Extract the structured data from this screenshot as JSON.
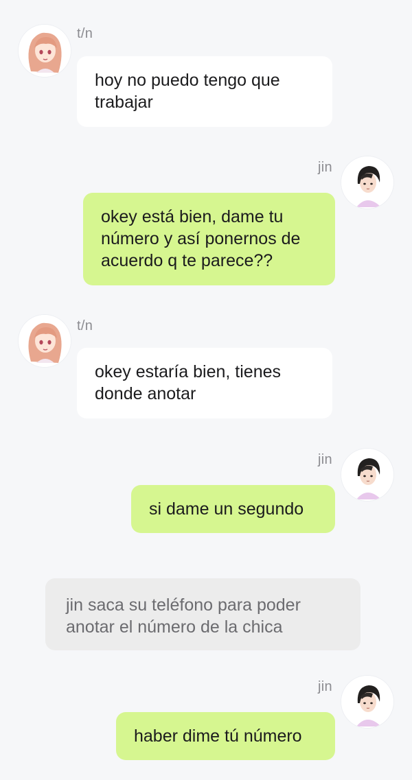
{
  "colors": {
    "background": "#f6f7f9",
    "incoming_bubble": "#ffffff",
    "outgoing_bubble": "#d6f690",
    "narration_bubble": "#ececec",
    "name_text": "#8b8b90"
  },
  "participants": {
    "her": {
      "name": "t/n",
      "avatar": "anime-girl-avatar"
    },
    "him": {
      "name": "jin",
      "avatar": "anime-boy-avatar"
    }
  },
  "messages": [
    {
      "sender": "t/n",
      "text": "hoy no puedo tengo que\ntrabajar"
    },
    {
      "sender": "jin",
      "text": "okey está bien, dame tu\nnúmero y así ponernos de\nacuerdo q te parece??"
    },
    {
      "sender": "t/n",
      "text": "okey estaría bien, tienes\ndonde anotar"
    },
    {
      "sender": "jin",
      "text": "si dame un segundo"
    },
    {
      "sender": "narration",
      "text": "jin saca su teléfono para poder\nanotar el número de la chica"
    },
    {
      "sender": "jin",
      "text": "haber dime tú número"
    }
  ]
}
